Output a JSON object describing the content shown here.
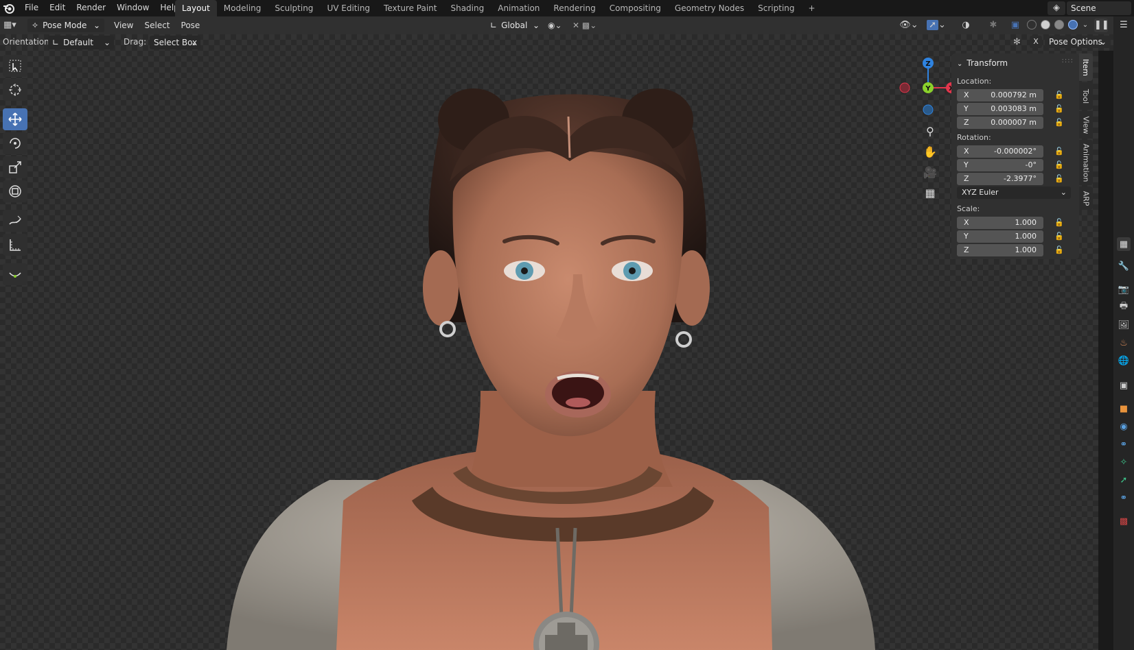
{
  "topbar": {
    "menu": [
      "File",
      "Edit",
      "Render",
      "Window",
      "Help"
    ],
    "workspaces": [
      "Layout",
      "Modeling",
      "Sculpting",
      "UV Editing",
      "Texture Paint",
      "Shading",
      "Animation",
      "Rendering",
      "Compositing",
      "Geometry Nodes",
      "Scripting"
    ],
    "active_workspace": "Layout",
    "add_label": "+",
    "scene_name": "Scene"
  },
  "header": {
    "mode": "Pose Mode",
    "menus": [
      "View",
      "Select",
      "Pose"
    ],
    "transform_orientation": "Global"
  },
  "tool_header": {
    "orientation_label": "Orientation:",
    "orientation_value": "Default",
    "drag_label": "Drag:",
    "drag_value": "Select Box",
    "x_mirror": "X",
    "pose_options": "Pose Options"
  },
  "tools": [
    {
      "name": "select-box-tool",
      "icon": "select-box-icon"
    },
    {
      "name": "cursor-tool",
      "icon": "cursor-icon"
    },
    {
      "name": "move-tool",
      "icon": "move-icon",
      "active": true
    },
    {
      "name": "rotate-tool",
      "icon": "rotate-icon"
    },
    {
      "name": "scale-tool",
      "icon": "scale-icon"
    },
    {
      "name": "transform-tool",
      "icon": "transform-icon"
    },
    {
      "name": "annotate-tool",
      "icon": "annotate-icon"
    },
    {
      "name": "measure-tool",
      "icon": "measure-icon"
    },
    {
      "name": "relax-pose-tool",
      "icon": "relax-icon"
    }
  ],
  "gizmo": {
    "z": "Z",
    "y": "Y",
    "x": "X"
  },
  "transform_panel": {
    "title": "Transform",
    "location_label": "Location:",
    "location": [
      {
        "axis": "X",
        "value": "0.000792 m"
      },
      {
        "axis": "Y",
        "value": "0.003083 m"
      },
      {
        "axis": "Z",
        "value": "0.000007 m"
      }
    ],
    "rotation_label": "Rotation:",
    "rotation": [
      {
        "axis": "X",
        "value": "-0.000002°"
      },
      {
        "axis": "Y",
        "value": "-0°"
      },
      {
        "axis": "Z",
        "value": "-2.3977°"
      }
    ],
    "rotation_mode": "XYZ Euler",
    "scale_label": "Scale:",
    "scale": [
      {
        "axis": "X",
        "value": "1.000"
      },
      {
        "axis": "Y",
        "value": "1.000"
      },
      {
        "axis": "Z",
        "value": "1.000"
      }
    ]
  },
  "sidebar_tabs": [
    "Item",
    "Tool",
    "View",
    "Animation",
    "ARP"
  ],
  "colors": {
    "accent": "#4772b3",
    "axis_x": "#e2364c",
    "axis_y": "#8ad12c",
    "axis_z": "#2f83e0"
  }
}
